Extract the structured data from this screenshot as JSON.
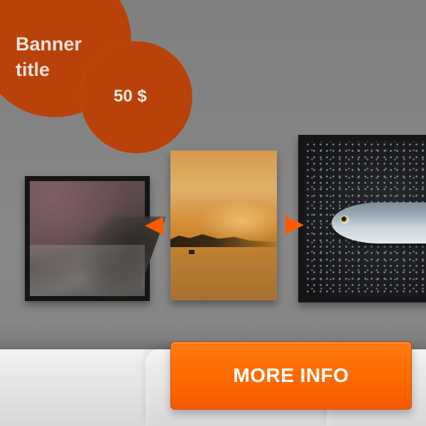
{
  "banner": {
    "title": "Banner title",
    "price": "50 $",
    "accent_color": "#b8420a"
  },
  "gallery": {
    "items": [
      {
        "name": "misty-shore-print"
      },
      {
        "name": "sunset-beach-canvas"
      },
      {
        "name": "fish-on-salt-print"
      }
    ],
    "prev_icon": "triangle-left-icon",
    "next_icon": "triangle-right-icon",
    "arrow_color": "#ff5a00"
  },
  "cta": {
    "label": "MORE INFO",
    "color": "#ff6a00"
  }
}
